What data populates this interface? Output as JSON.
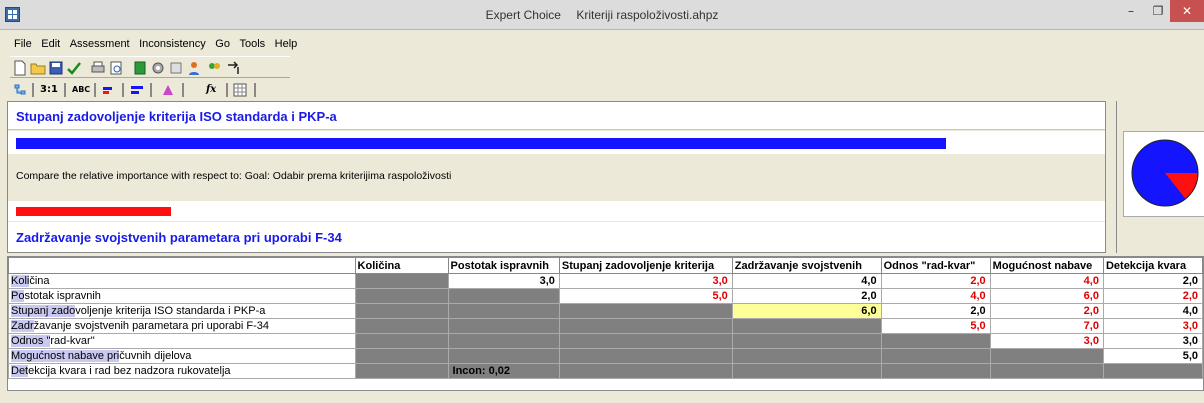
{
  "window": {
    "app_name": "Expert Choice",
    "file_name": "Kriteriji raspoloživosti.ahpz",
    "min_glyph": "–",
    "max_glyph": "❐",
    "close_glyph": "✕"
  },
  "menu": [
    "File",
    "Edit",
    "Assessment",
    "Inconsistency",
    "Go",
    "Tools",
    "Help"
  ],
  "toolbar2": {
    "ratio_label": "3:1",
    "abc_label": "ABC",
    "fx_label": "fx"
  },
  "compare": {
    "left_criterion": "Stupanj zadovoljenje kriterija ISO standarda i PKP-a",
    "right_criterion": "Zadržavanje svojstvenih parametara pri uporabi F-34",
    "prompt": "Compare the relative importance with respect to: Goal: Odabir prema kriterijima raspoloživosti",
    "left_bar_fraction": 0.86,
    "right_bar_fraction": 0.143,
    "pie_left_fraction": 0.857
  },
  "colors": {
    "left": "#1414ff",
    "right": "#ff1010"
  },
  "grid": {
    "columns": [
      "Količina",
      "Postotak ispravnih",
      "Stupanj zadovoljenje kriterija",
      "Zadržavanje svojstvenih",
      "Odnos \"rad-kvar\"",
      "Mogućnost nabave",
      "Detekcija kvara"
    ],
    "rows": [
      {
        "label": "Količina",
        "hl": "Koli",
        "rest": "čina",
        "cells": [
          [
            "gray",
            ""
          ],
          [
            "black",
            "3,0"
          ],
          [
            "red",
            "3,0"
          ],
          [
            "black",
            "4,0"
          ],
          [
            "red",
            "2,0"
          ],
          [
            "red",
            "4,0"
          ],
          [
            "black",
            "2,0"
          ]
        ]
      },
      {
        "label": "Postotak ispravnih",
        "hl": "Po",
        "rest": "stotak ispravnih",
        "cells": [
          [
            "gray",
            ""
          ],
          [
            "gray",
            ""
          ],
          [
            "red",
            "5,0"
          ],
          [
            "black",
            "2,0"
          ],
          [
            "red",
            "4,0"
          ],
          [
            "red",
            "6,0"
          ],
          [
            "red",
            "2,0"
          ]
        ]
      },
      {
        "label": "Stupanj zadovoljenje kriterija ISO standarda i PKP-a",
        "hl": "Stupanj zado",
        "rest": "voljenje kriterija ISO standarda i PKP-a",
        "cells": [
          [
            "gray",
            ""
          ],
          [
            "gray",
            ""
          ],
          [
            "gray",
            ""
          ],
          [
            "selected",
            "6,0"
          ],
          [
            "black",
            "2,0"
          ],
          [
            "red",
            "2,0"
          ],
          [
            "black",
            "4,0"
          ]
        ]
      },
      {
        "label": "Zadržavanje svojstvenih parametara pri uporabi F-34",
        "hl": "Zadr",
        "rest": "žavanje svojstvenih parametara pri uporabi F-34",
        "cells": [
          [
            "gray",
            ""
          ],
          [
            "gray",
            ""
          ],
          [
            "gray",
            ""
          ],
          [
            "gray",
            ""
          ],
          [
            "red",
            "5,0"
          ],
          [
            "red",
            "7,0"
          ],
          [
            "red",
            "3,0"
          ]
        ]
      },
      {
        "label": "Odnos \"rad-kvar\"",
        "hl": "Odnos \"",
        "rest": "rad-kvar\"",
        "cells": [
          [
            "gray",
            ""
          ],
          [
            "gray",
            ""
          ],
          [
            "gray",
            ""
          ],
          [
            "gray",
            ""
          ],
          [
            "gray",
            ""
          ],
          [
            "red",
            "3,0"
          ],
          [
            "black",
            "3,0"
          ]
        ]
      },
      {
        "label": "Mogućnost nabave pričuvnih dijelova",
        "hl": "Mogućnost nabave pri",
        "rest": "čuvnih dijelova",
        "cells": [
          [
            "gray",
            ""
          ],
          [
            "gray",
            ""
          ],
          [
            "gray",
            ""
          ],
          [
            "gray",
            ""
          ],
          [
            "gray",
            ""
          ],
          [
            "gray",
            ""
          ],
          [
            "black",
            "5,0"
          ]
        ]
      },
      {
        "label": "Detekcija kvara i rad bez  nadzora rukovatelja",
        "hl": "Det",
        "rest": "ekcija kvara i rad bez  nadzora rukovatelja",
        "cells": [
          [
            "gray",
            ""
          ],
          [
            "incon",
            "Incon: 0,02"
          ],
          [
            "gray",
            ""
          ],
          [
            "gray",
            ""
          ],
          [
            "gray",
            ""
          ],
          [
            "gray",
            ""
          ],
          [
            "gray",
            ""
          ]
        ]
      }
    ]
  }
}
